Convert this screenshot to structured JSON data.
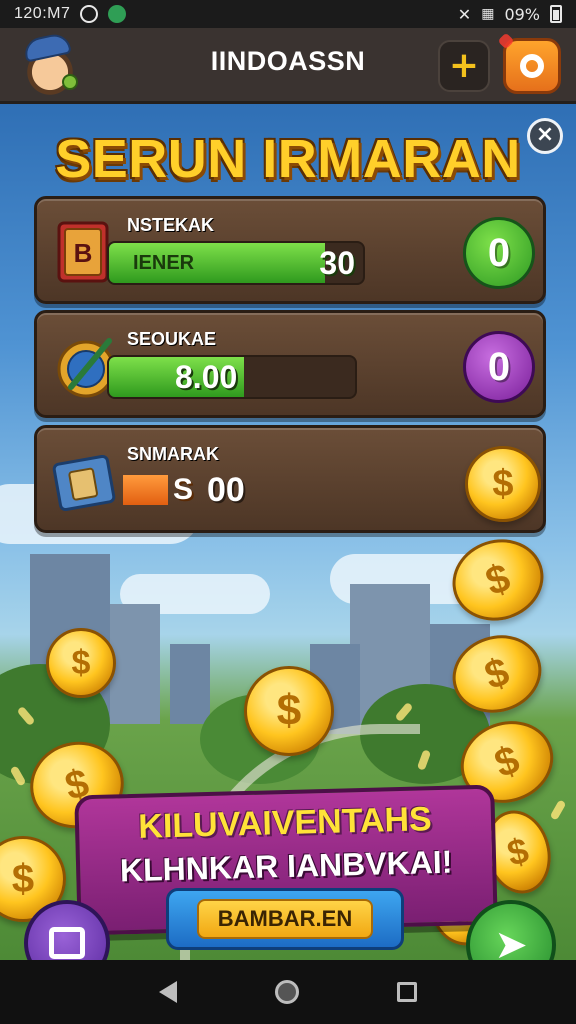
{
  "status_bar": {
    "time": "120:M7",
    "battery": "09%"
  },
  "header": {
    "title": "IINDOASSN",
    "plus_label": "+"
  },
  "screen_title": "SERUN IRMARAN",
  "close_label": "×",
  "tasks": [
    {
      "label": "NSTEKAK",
      "bar_text": "IENER",
      "value": "30",
      "progress": 0.85,
      "button_label": "0",
      "color": "#3db82f"
    },
    {
      "label": "SEOUKAE",
      "value": "8.00",
      "progress": 0.55,
      "button_label": "0",
      "color": "#9b3bb3"
    },
    {
      "label": "SNMARAK",
      "currency": "S",
      "value": "00",
      "progress": 0.3,
      "color": "#f2a114"
    }
  ],
  "banner": {
    "line1": "KILUVAIVENTAHS",
    "line2": "KLHNKAR IANBVKAI!",
    "button_label": "BAMBAR.EN"
  },
  "coin_symbol": "$"
}
